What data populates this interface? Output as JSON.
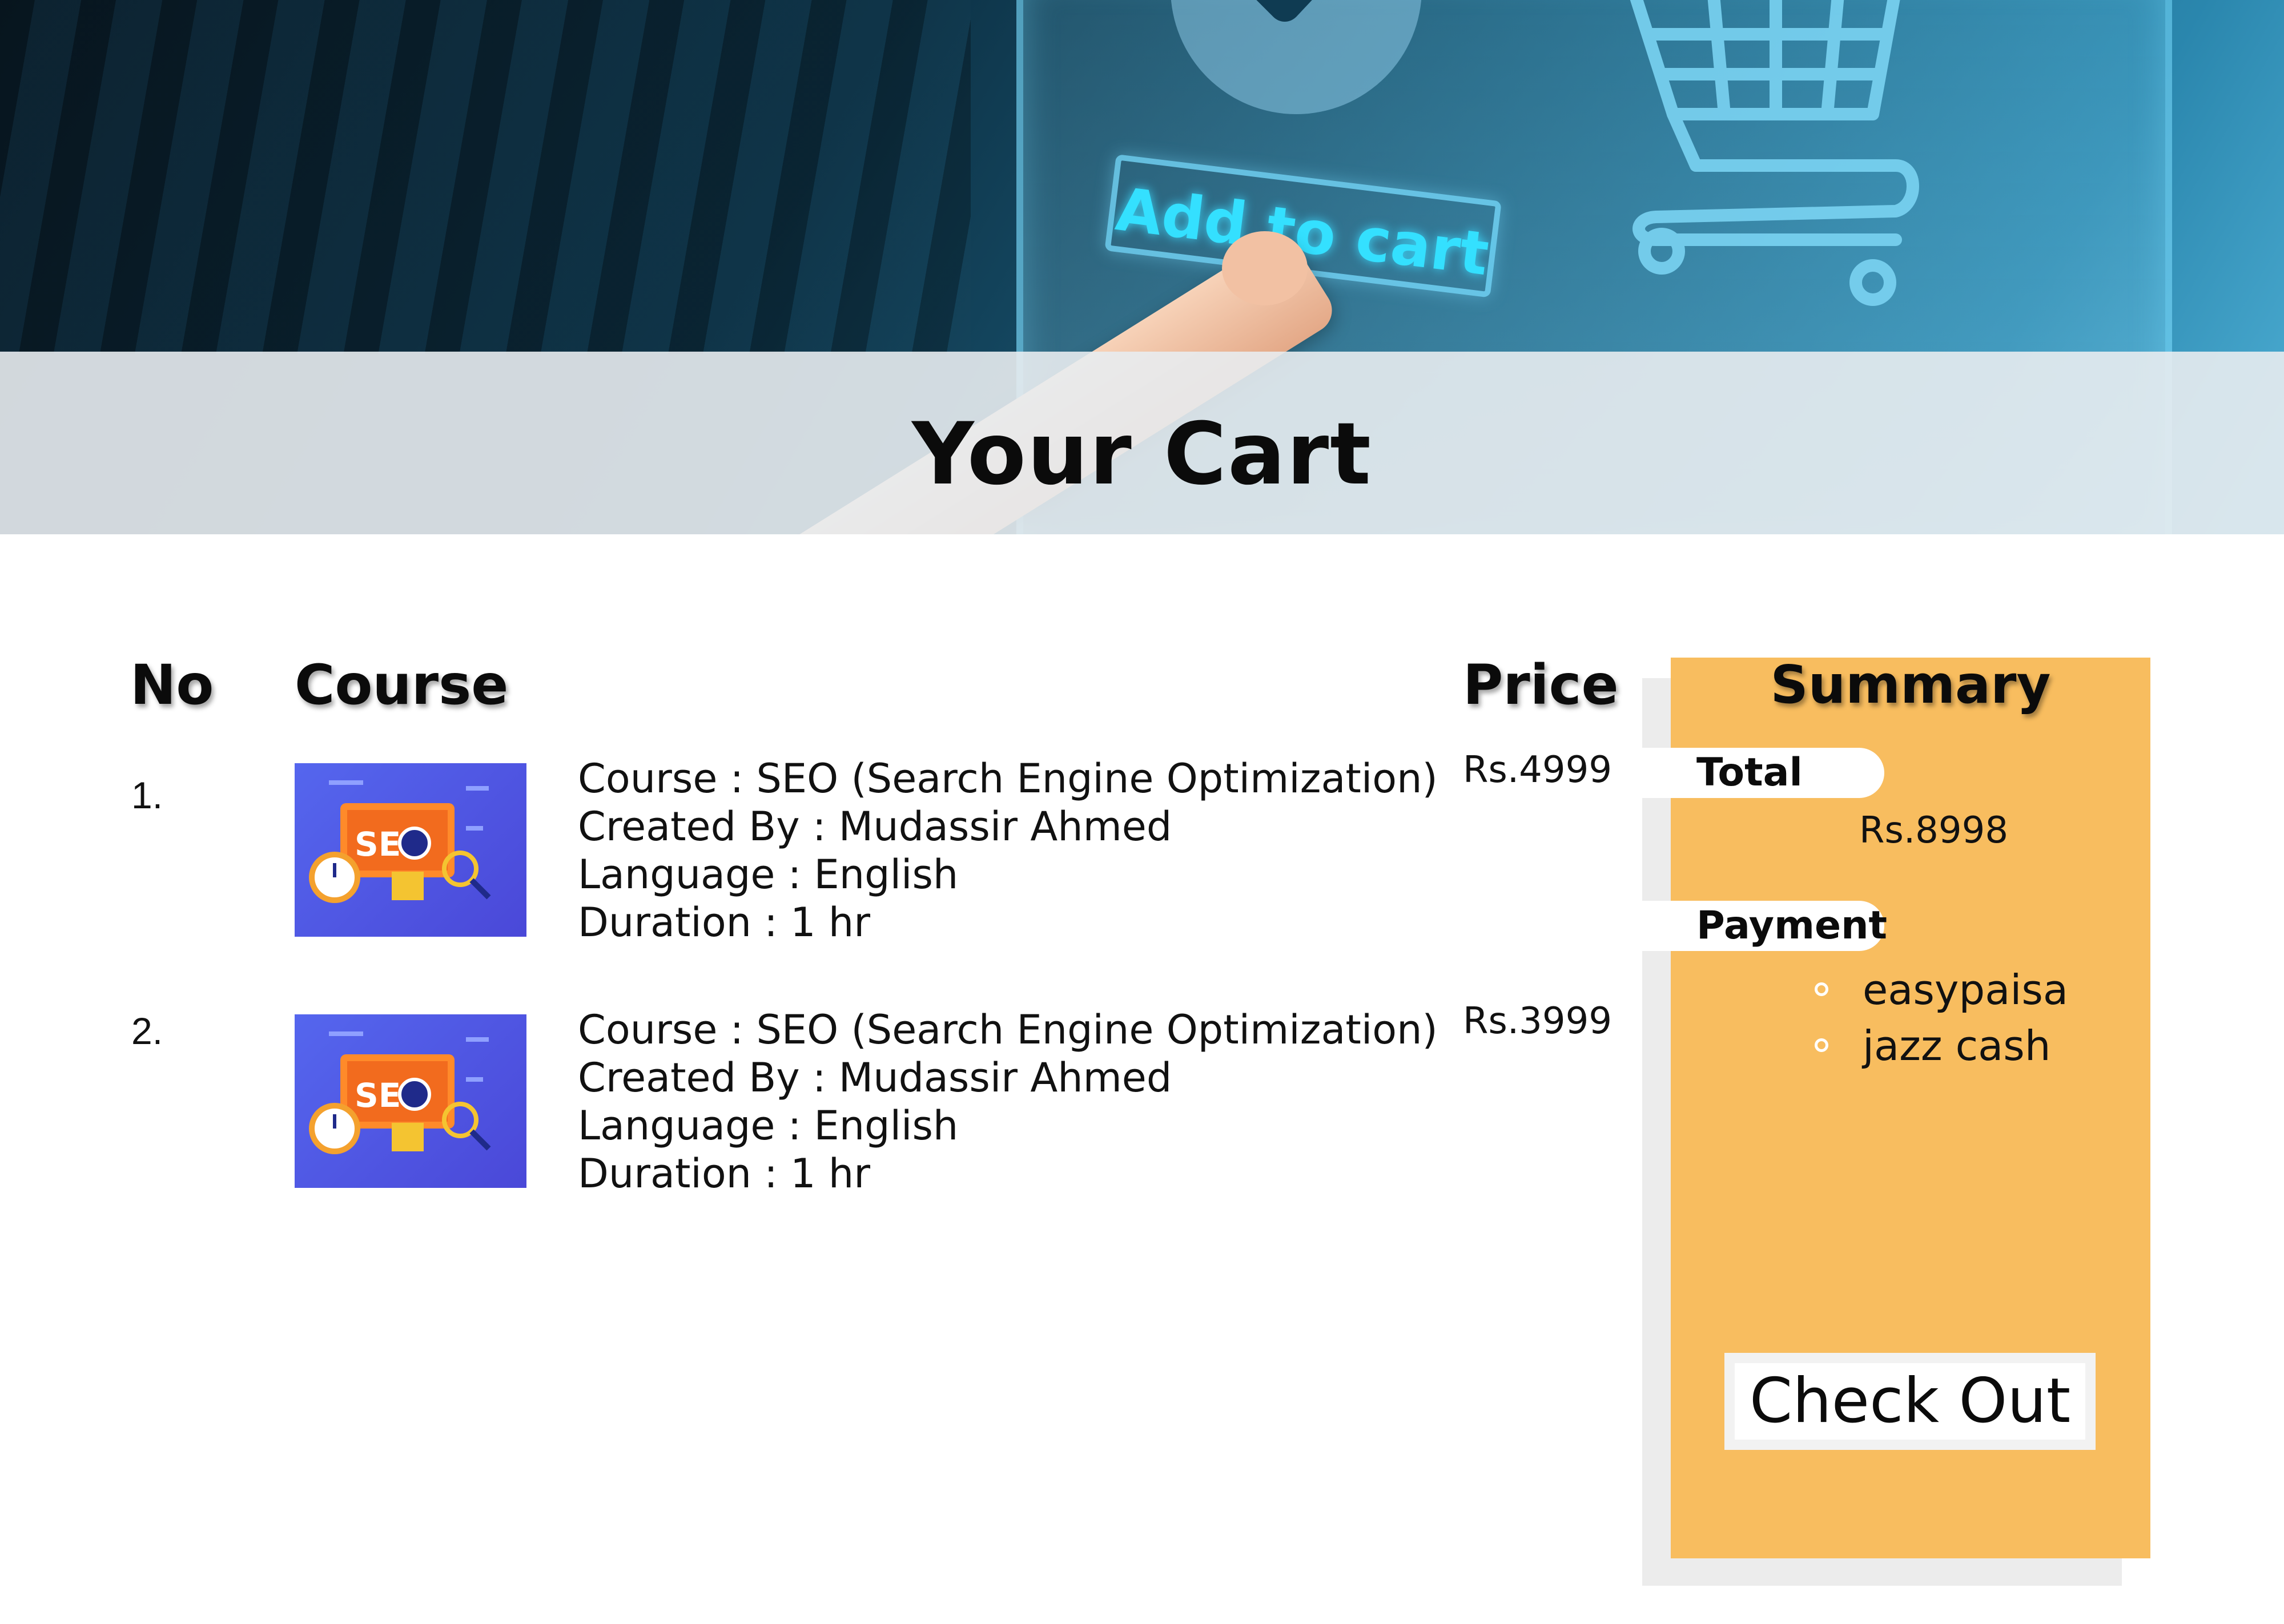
{
  "hero": {
    "button_text": "Add to cart"
  },
  "page": {
    "title": "Your Cart"
  },
  "table": {
    "headers": {
      "no": "No",
      "course": "Course",
      "price": "Price"
    },
    "rows": [
      {
        "no": "1.",
        "thumbnail_label": "SEO",
        "course_line": "Course : SEO (Search Engine Optimization)",
        "created_by_line": "Created By : Mudassir Ahmed",
        "language_line": "Language : English",
        "duration_line": "Duration : 1 hr",
        "price": "Rs.4999"
      },
      {
        "no": "2.",
        "thumbnail_label": "SEO",
        "course_line": "Course : SEO (Search Engine Optimization)",
        "created_by_line": "Created By : Mudassir Ahmed",
        "language_line": "Language : English",
        "duration_line": "Duration : 1 hr",
        "price": "Rs.3999"
      }
    ]
  },
  "summary": {
    "title": "Summary",
    "total_label": "Total",
    "total_amount": "Rs.8998",
    "payment_label": "Payment",
    "payment_options": [
      "easypaisa",
      "jazz cash"
    ],
    "checkout_label": "Check Out"
  },
  "colors": {
    "summary_panel": "#f8bd5f",
    "thumbnail_bg": "#4f4fe0",
    "title_band": "#e8ecf0"
  }
}
